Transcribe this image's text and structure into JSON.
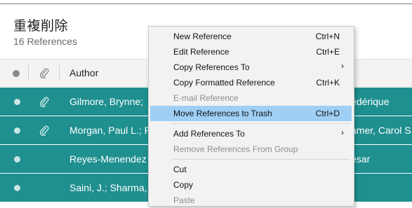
{
  "group": {
    "title": "重複削除",
    "count": "16 References"
  },
  "table": {
    "author_header": "Author",
    "rows": [
      {
        "author": "Gilmore, Brynne;",
        "right": "édérique",
        "attached": true
      },
      {
        "author": "Morgan, Paul L.; P",
        "right": "amer, Carol S",
        "attached": true
      },
      {
        "author": "Reyes-Menendez",
        "right": "esar",
        "attached": false
      },
      {
        "author": "Saini, J.; Sharma,",
        "right": "",
        "attached": false
      }
    ]
  },
  "context_menu": {
    "items": [
      {
        "label": "New Reference",
        "shortcut": "Ctrl+N"
      },
      {
        "label": "Edit Reference",
        "shortcut": "Ctrl+E"
      },
      {
        "label": "Copy References To",
        "shortcut": ""
      },
      {
        "label": "Copy Formatted Reference",
        "shortcut": "Ctrl+K"
      },
      {
        "label": "E-mail Reference",
        "shortcut": "",
        "disabled": true
      },
      {
        "label": "Move References to Trash",
        "shortcut": "Ctrl+D",
        "selected": true
      },
      {
        "label": "Add References To",
        "shortcut": ""
      },
      {
        "label": "Remove References From Group",
        "shortcut": "",
        "disabled": true
      },
      {
        "label": "Cut",
        "shortcut": ""
      },
      {
        "label": "Copy",
        "shortcut": ""
      },
      {
        "label": "Paste",
        "shortcut": "",
        "disabled": true
      }
    ],
    "submenu_arrow": "›"
  },
  "colors": {
    "selected_row": "#1f8f8f",
    "menu_highlight": "#9fcff5"
  },
  "icons": {
    "read_status": "dot-icon",
    "attachment": "paperclip-icon",
    "submenu": "chevron-right-icon"
  }
}
